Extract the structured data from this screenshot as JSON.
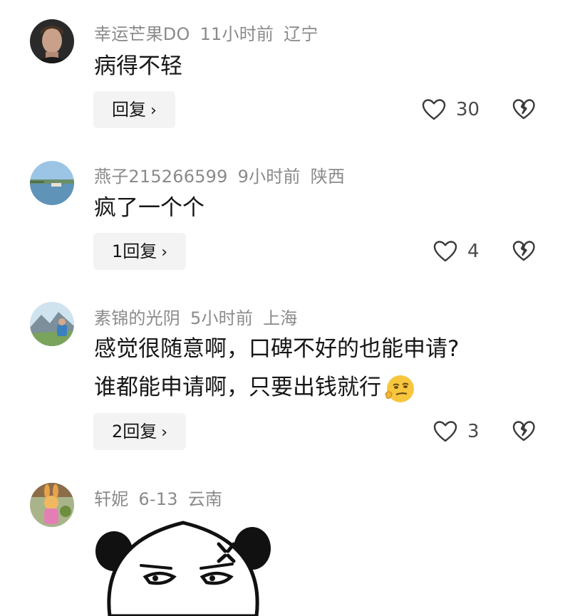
{
  "comments": [
    {
      "username": "幸运芒果DO",
      "time": "11小时前",
      "location": "辽宁",
      "text": "病得不轻",
      "reply_label": "回复",
      "likes": "30",
      "avatar_icon": "portrait-man-avatar"
    },
    {
      "username": "燕子215266599",
      "time": "9小时前",
      "location": "陕西",
      "text": "疯了一个个",
      "reply_label": "1回复",
      "likes": "4",
      "avatar_icon": "lake-scenery-avatar"
    },
    {
      "username": "素锦的光阴",
      "time": "5小时前",
      "location": "上海",
      "text_line1": "感觉很随意啊，口碑不好的也能申请?",
      "text_line2": "谁都能申请啊，只要出钱就行",
      "reply_label": "2回复",
      "likes": "3",
      "avatar_icon": "mountain-landscape-avatar",
      "emoji": "smirk-emoji"
    },
    {
      "username": "轩妮",
      "time": "6-13",
      "location": "云南",
      "avatar_icon": "cartoon-rabbit-avatar",
      "sticker": "angry-panda-sticker"
    }
  ],
  "icons": {
    "like": "heart-outline-icon",
    "dislike": "broken-heart-icon",
    "chevron": "chevron-right-icon"
  },
  "colors": {
    "meta_text": "#8a8a8a",
    "reply_bg": "#f3f3f3",
    "icon_stroke": "#3a3a3a"
  }
}
